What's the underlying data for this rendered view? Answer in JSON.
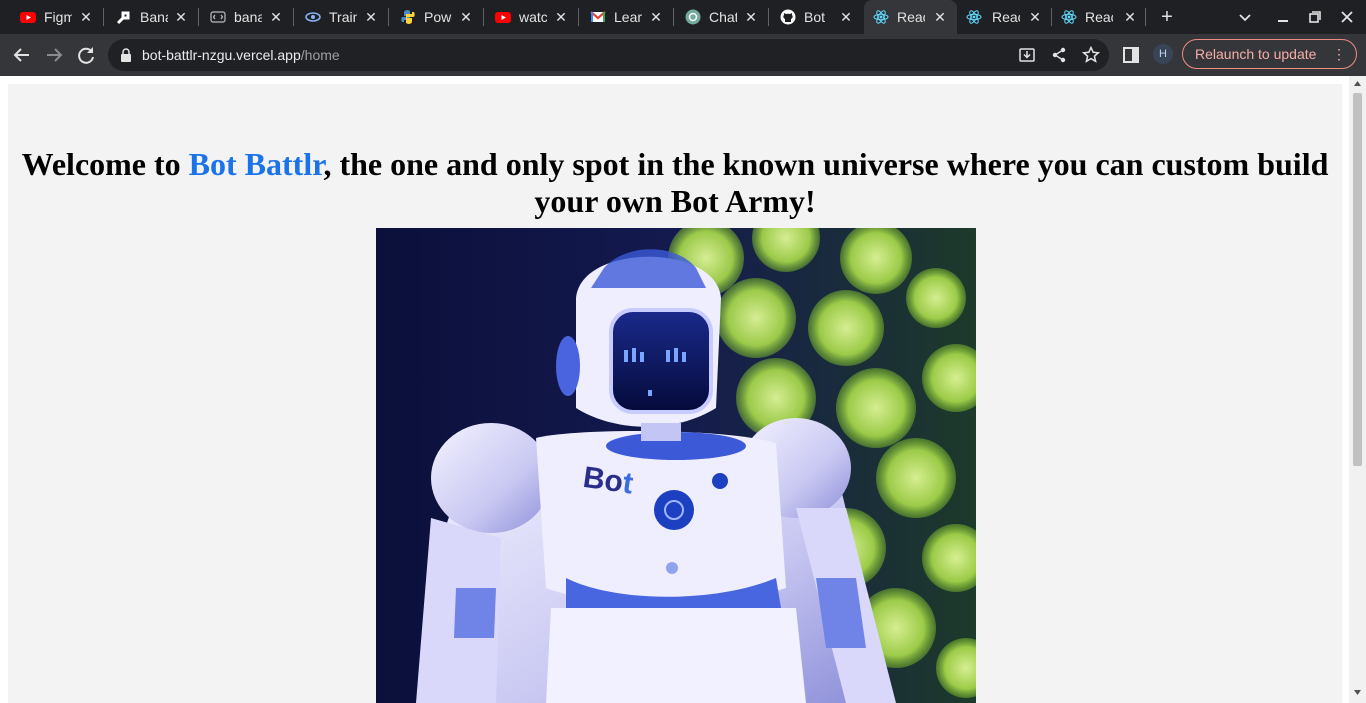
{
  "browser": {
    "tabs": [
      {
        "title": "Figma",
        "icon": "youtube-icon"
      },
      {
        "title": "Banana",
        "icon": "banana-icon"
      },
      {
        "title": "banana",
        "icon": "code-sandbox-icon"
      },
      {
        "title": "Train",
        "icon": "eye-icon"
      },
      {
        "title": "Power",
        "icon": "python-icon"
      },
      {
        "title": "watch",
        "icon": "youtube-icon"
      },
      {
        "title": "Learn",
        "icon": "gmail-icon"
      },
      {
        "title": "Chat",
        "icon": "chatgpt-icon"
      },
      {
        "title": "Bot",
        "icon": "github-icon"
      },
      {
        "title": "React",
        "icon": "react-icon",
        "active": true
      },
      {
        "title": "React",
        "icon": "react-icon"
      },
      {
        "title": "React",
        "icon": "react-icon"
      }
    ],
    "address": {
      "host": "bot-battlr-nzgu.vercel.app",
      "path": "/home"
    },
    "profile_initial": "H",
    "relaunch_label": "Relaunch to update"
  },
  "page": {
    "heading_prefix": "Welcome to ",
    "heading_brand": "Bot Battlr",
    "heading_suffix": ", the one and only spot in the known universe where you can custom build your own Bot Army!",
    "hero_image_text": "Bot"
  },
  "colors": {
    "brand": "#1a73e8",
    "relaunch": "#f28b82",
    "tabstrip": "#1f2023",
    "toolbar": "#35363a"
  }
}
